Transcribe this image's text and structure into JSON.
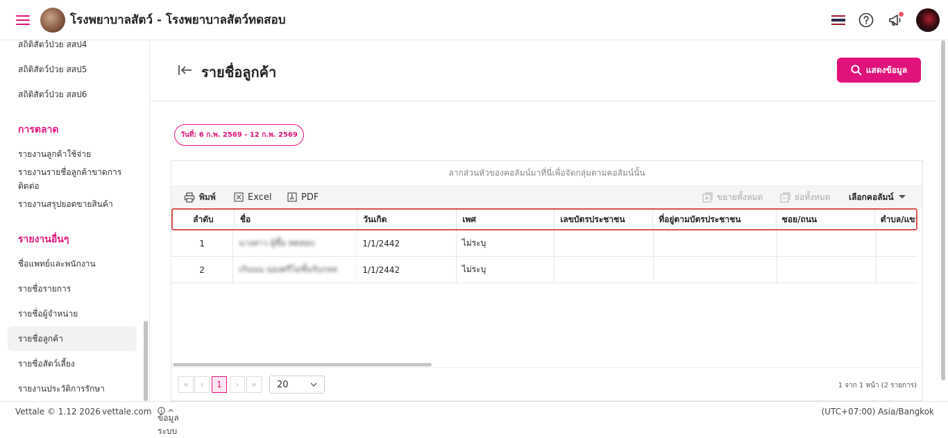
{
  "header": {
    "app_title": "โรงพยาบาลสัตว์ - โรงพยาบาลสัตว์ทดสอบ",
    "flag_colors": [
      "#a51931",
      "#f4f5f8",
      "#2d2a4a",
      "#f4f5f8",
      "#a51931"
    ],
    "icons": [
      "menu-icon",
      "help-icon",
      "megaphone-icon"
    ]
  },
  "sidebar": {
    "items_top": [
      "สถิติสัตว์ป่วย สสป4",
      "สถิติสัตว์ป่วย สสป5",
      "สถิติสัตว์ป่วย สสป6"
    ],
    "section_marketing": "การตลาด",
    "marketing_items": [
      "รายงานลูกค้าใช้จ่าย",
      "รายงานรายชื่อลูกค้าขาดการ",
      "ติดต่อ",
      "รายงานสรุปยอดขายสินค้า"
    ],
    "section_other": "รายงานอื่นๆ",
    "other_items": [
      "ชื่อแพทย์และพนักงาน",
      "รายชื่อรายการ",
      "รายชื่อผู้จำหน่าย",
      "รายชื่อลูกค้า",
      "รายชื่อสัตว์เลี้ยง",
      "รายงานประวัติการรักษา"
    ],
    "active_item": "รายชื่อลูกค้า"
  },
  "page": {
    "title": "รายชื่อลูกค้า",
    "show_button": "แสดงข้อมูล",
    "date_range": "วันที่: 6 ก.พ. 2569 - 12 ก.พ. 2569"
  },
  "grid": {
    "group_hint": "ลากส่วนหัวของคอลัมน์มาที่นี่เพื่อจัดกลุ่มตามคอลัมน์นั้น",
    "toolbar": {
      "print": "พิมพ์",
      "excel": "Excel",
      "pdf": "PDF",
      "expand_all": "ขยายทั้งหมด",
      "collapse_all": "ย่อทั้งหมด",
      "choose_columns": "เลือกคอลัมน์"
    },
    "columns": [
      "ลำดับ",
      "ชื่อ",
      "วันเกิด",
      "เพศ",
      "เลขบัตรประชาชน",
      "ที่อยู่ตามบัตรประชาชน",
      "ซอย/ถนน",
      "ตำบล/แขวง"
    ],
    "rows": [
      {
        "no": "1",
        "name": "นางสาว ผู้ซื้อ ทดสอบ",
        "birth": "1/1/2442",
        "sex": "ไม่ระบุ"
      },
      {
        "no": "2",
        "name": "เกินนน น่องศรีไม่ชั้นรับกหล",
        "birth": "1/1/2442",
        "sex": "ไม่ระบุ"
      }
    ],
    "pager": {
      "first": "«",
      "prev": "‹",
      "current": "1",
      "next": "›",
      "last": "»",
      "page_size": "20",
      "info": "1 จาก 1 หน้า (2 รายการ)"
    }
  },
  "footer": {
    "version": "Vettale © 1.12 2026",
    "site": "vettale.com",
    "system_info": "ข้อมูลระบบ",
    "timezone": "(UTC+07:00) Asia/Bangkok"
  },
  "colors": {
    "accent": "#e0127c",
    "highlight_border": "#d9534f"
  }
}
